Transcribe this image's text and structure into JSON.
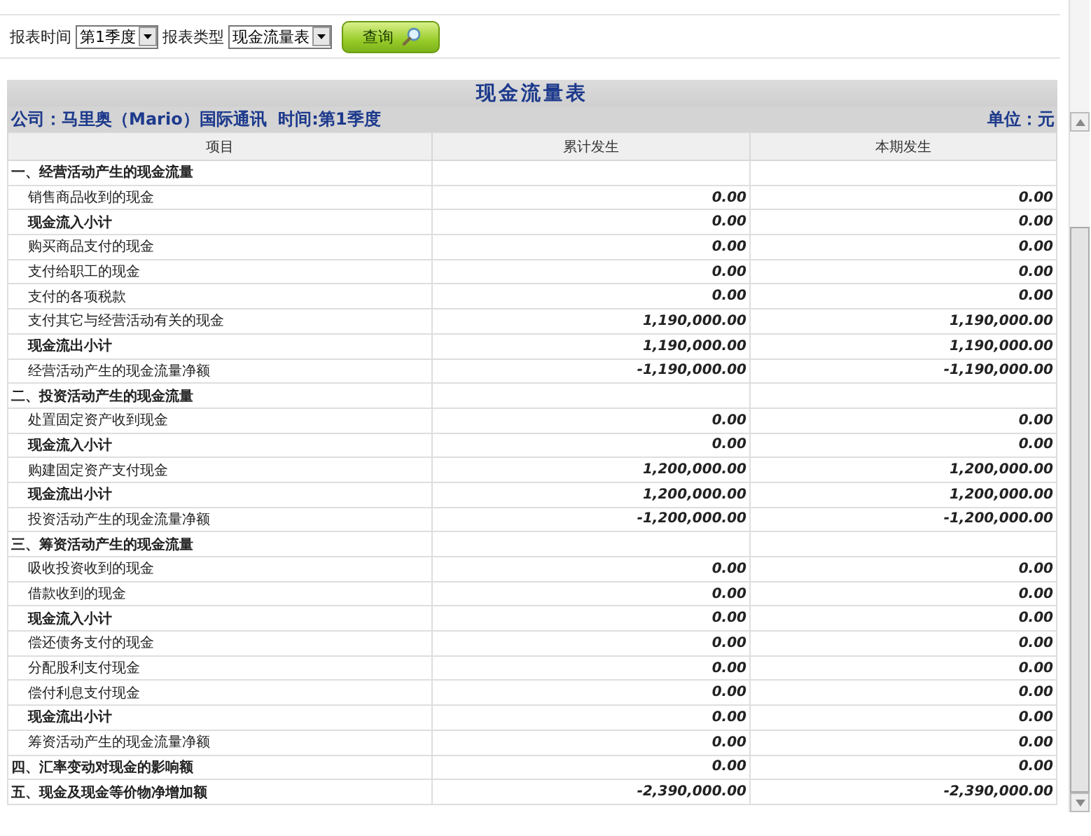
{
  "filters": [
    {
      "label": "报表时间",
      "value": "第1季度"
    },
    {
      "label": "报表类型",
      "value": "现金流量表"
    }
  ],
  "query_button": "查询",
  "report": {
    "title": "现金流量表",
    "company": "公司：马里奥（Mario）国际通讯  时间:第1季度",
    "unit": "单位：元",
    "columns": [
      "项目",
      "累计发生",
      "本期发生"
    ],
    "rows": [
      {
        "kind": "section",
        "label": "一、经营活动产生的现金流量"
      },
      {
        "kind": "item",
        "label": "销售商品收到的现金",
        "values": [
          "0.00",
          "0.00"
        ]
      },
      {
        "kind": "subtotal",
        "label": "现金流入小计",
        "values": [
          "0.00",
          "0.00"
        ]
      },
      {
        "kind": "item",
        "label": "购买商品支付的现金",
        "values": [
          "0.00",
          "0.00"
        ]
      },
      {
        "kind": "item",
        "label": "支付给职工的现金",
        "values": [
          "0.00",
          "0.00"
        ]
      },
      {
        "kind": "item",
        "label": "支付的各项税款",
        "values": [
          "0.00",
          "0.00"
        ]
      },
      {
        "kind": "item",
        "label": "支付其它与经营活动有关的现金",
        "values": [
          "1,190,000.00",
          "1,190,000.00"
        ]
      },
      {
        "kind": "subtotal",
        "label": "现金流出小计",
        "values": [
          "1,190,000.00",
          "1,190,000.00"
        ]
      },
      {
        "kind": "item",
        "label": "经营活动产生的现金流量净额",
        "values": [
          "-1,190,000.00",
          "-1,190,000.00"
        ]
      },
      {
        "kind": "section",
        "label": "二、投资活动产生的现金流量"
      },
      {
        "kind": "item",
        "label": "处置固定资产收到现金",
        "values": [
          "0.00",
          "0.00"
        ]
      },
      {
        "kind": "subtotal",
        "label": "现金流入小计",
        "values": [
          "0.00",
          "0.00"
        ]
      },
      {
        "kind": "item",
        "label": "购建固定资产支付现金",
        "values": [
          "1,200,000.00",
          "1,200,000.00"
        ]
      },
      {
        "kind": "subtotal",
        "label": "现金流出小计",
        "values": [
          "1,200,000.00",
          "1,200,000.00"
        ]
      },
      {
        "kind": "item",
        "label": "投资活动产生的现金流量净额",
        "values": [
          "-1,200,000.00",
          "-1,200,000.00"
        ]
      },
      {
        "kind": "section",
        "label": "三、筹资活动产生的现金流量"
      },
      {
        "kind": "item",
        "label": "吸收投资收到的现金",
        "values": [
          "0.00",
          "0.00"
        ]
      },
      {
        "kind": "item",
        "label": "借款收到的现金",
        "values": [
          "0.00",
          "0.00"
        ]
      },
      {
        "kind": "subtotal",
        "label": "现金流入小计",
        "values": [
          "0.00",
          "0.00"
        ]
      },
      {
        "kind": "item",
        "label": "偿还债务支付的现金",
        "values": [
          "0.00",
          "0.00"
        ]
      },
      {
        "kind": "item",
        "label": "分配股利支付现金",
        "values": [
          "0.00",
          "0.00"
        ]
      },
      {
        "kind": "item",
        "label": "偿付利息支付现金",
        "values": [
          "0.00",
          "0.00"
        ]
      },
      {
        "kind": "subtotal",
        "label": "现金流出小计",
        "values": [
          "0.00",
          "0.00"
        ]
      },
      {
        "kind": "item",
        "label": "筹资活动产生的现金流量净额",
        "values": [
          "0.00",
          "0.00"
        ]
      },
      {
        "kind": "section",
        "label": "四、汇率变动对现金的影响额",
        "values": [
          "0.00",
          "0.00"
        ]
      },
      {
        "kind": "section",
        "label": "五、现金及现金等价物净增加额",
        "values": [
          "-2,390,000.00",
          "-2,390,000.00"
        ]
      }
    ]
  }
}
